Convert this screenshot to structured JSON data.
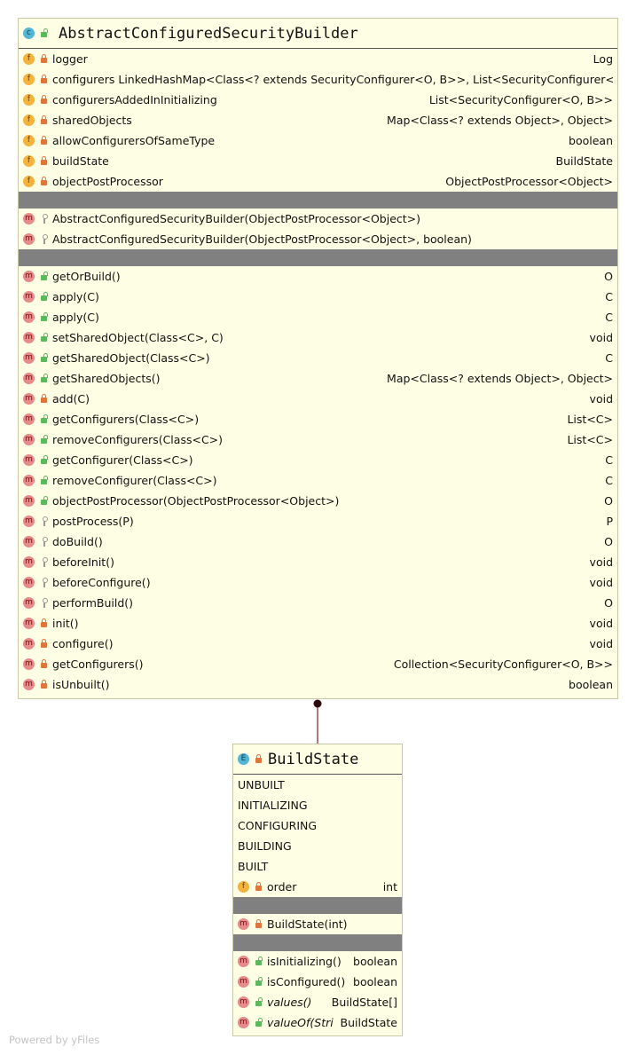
{
  "main_class": {
    "kind_letter": "c",
    "title": "AbstractConfiguredSecurityBuilder",
    "fields": [
      {
        "icon": "field-icon",
        "vis": "private",
        "name": "logger",
        "type": "Log"
      },
      {
        "icon": "field-icon",
        "vis": "private",
        "name": "configurers LinkedHashMap<Class<? extends SecurityConfigurer<O, B>>, List<SecurityConfigurer<O, B>>>",
        "type": ""
      },
      {
        "icon": "field-icon",
        "vis": "private",
        "name": "configurersAddedInInitializing",
        "type": "List<SecurityConfigurer<O, B>>"
      },
      {
        "icon": "field-icon",
        "vis": "private",
        "name": "sharedObjects",
        "type": "Map<Class<? extends Object>, Object>"
      },
      {
        "icon": "field-icon",
        "vis": "private",
        "name": "allowConfigurersOfSameType",
        "type": "boolean"
      },
      {
        "icon": "field-icon",
        "vis": "private",
        "name": "buildState",
        "type": "BuildState"
      },
      {
        "icon": "field-icon",
        "vis": "private",
        "name": "objectPostProcessor",
        "type": "ObjectPostProcessor<Object>"
      }
    ],
    "constructors": [
      {
        "icon": "method-icon",
        "vis": "protected",
        "name": "AbstractConfiguredSecurityBuilder(ObjectPostProcessor<Object>)",
        "type": ""
      },
      {
        "icon": "method-icon",
        "vis": "protected",
        "name": "AbstractConfiguredSecurityBuilder(ObjectPostProcessor<Object>, boolean)",
        "type": ""
      }
    ],
    "methods": [
      {
        "icon": "method-icon",
        "vis": "public",
        "name": "getOrBuild()",
        "type": "O"
      },
      {
        "icon": "method-icon",
        "vis": "public",
        "name": "apply(C)",
        "type": "C"
      },
      {
        "icon": "method-icon",
        "vis": "public",
        "name": "apply(C)",
        "type": "C"
      },
      {
        "icon": "method-icon",
        "vis": "public",
        "name": "setSharedObject(Class<C>, C)",
        "type": "void"
      },
      {
        "icon": "method-icon",
        "vis": "public",
        "name": "getSharedObject(Class<C>)",
        "type": "C"
      },
      {
        "icon": "method-icon",
        "vis": "public",
        "name": "getSharedObjects()",
        "type": "Map<Class<? extends Object>, Object>"
      },
      {
        "icon": "method-icon",
        "vis": "private",
        "name": "add(C)",
        "type": "void"
      },
      {
        "icon": "method-icon",
        "vis": "public",
        "name": "getConfigurers(Class<C>)",
        "type": "List<C>"
      },
      {
        "icon": "method-icon",
        "vis": "public",
        "name": "removeConfigurers(Class<C>)",
        "type": "List<C>"
      },
      {
        "icon": "method-icon",
        "vis": "public",
        "name": "getConfigurer(Class<C>)",
        "type": "C"
      },
      {
        "icon": "method-icon",
        "vis": "public",
        "name": "removeConfigurer(Class<C>)",
        "type": "C"
      },
      {
        "icon": "method-icon",
        "vis": "public",
        "name": "objectPostProcessor(ObjectPostProcessor<Object>)",
        "type": "O"
      },
      {
        "icon": "method-icon",
        "vis": "protected",
        "name": "postProcess(P)",
        "type": "P"
      },
      {
        "icon": "method-icon",
        "vis": "protected",
        "name": "doBuild()",
        "type": "O"
      },
      {
        "icon": "method-icon",
        "vis": "protected",
        "name": "beforeInit()",
        "type": "void"
      },
      {
        "icon": "method-icon",
        "vis": "protected",
        "name": "beforeConfigure()",
        "type": "void"
      },
      {
        "icon": "method-icon",
        "vis": "protected",
        "name": "performBuild()",
        "type": "O"
      },
      {
        "icon": "method-icon",
        "vis": "private",
        "name": "init()",
        "type": "void"
      },
      {
        "icon": "method-icon",
        "vis": "private",
        "name": "configure()",
        "type": "void"
      },
      {
        "icon": "method-icon",
        "vis": "private",
        "name": "getConfigurers()",
        "type": "Collection<SecurityConfigurer<O, B>>"
      },
      {
        "icon": "method-icon",
        "vis": "private",
        "name": "isUnbuilt()",
        "type": "boolean"
      }
    ]
  },
  "enum_class": {
    "kind_letter": "E",
    "title": "BuildState",
    "constants": [
      "UNBUILT",
      "INITIALIZING",
      "CONFIGURING",
      "BUILDING",
      "BUILT"
    ],
    "fields": [
      {
        "icon": "field-icon",
        "vis": "private",
        "name": "order",
        "type": "int"
      }
    ],
    "constructors": [
      {
        "icon": "method-icon",
        "vis": "private",
        "name": "BuildState(int)",
        "type": ""
      }
    ],
    "methods": [
      {
        "icon": "method-icon",
        "vis": "public",
        "name": "isInitializing()",
        "type": "boolean",
        "italic": false
      },
      {
        "icon": "method-icon",
        "vis": "public",
        "name": "isConfigured()",
        "type": "boolean",
        "italic": false
      },
      {
        "icon": "method-icon",
        "vis": "public",
        "name": "values()",
        "type": "BuildState[]",
        "italic": true
      },
      {
        "icon": "method-icon",
        "vis": "public",
        "name": "valueOf(String)",
        "type": "BuildState",
        "italic": true
      }
    ]
  },
  "icon_letters": {
    "field": "f",
    "method": "m"
  },
  "colors": {
    "box_fill": "#fefee4",
    "separator": "#808080",
    "connector": "#8b1a1a"
  },
  "footer": "Powered by yFiles"
}
